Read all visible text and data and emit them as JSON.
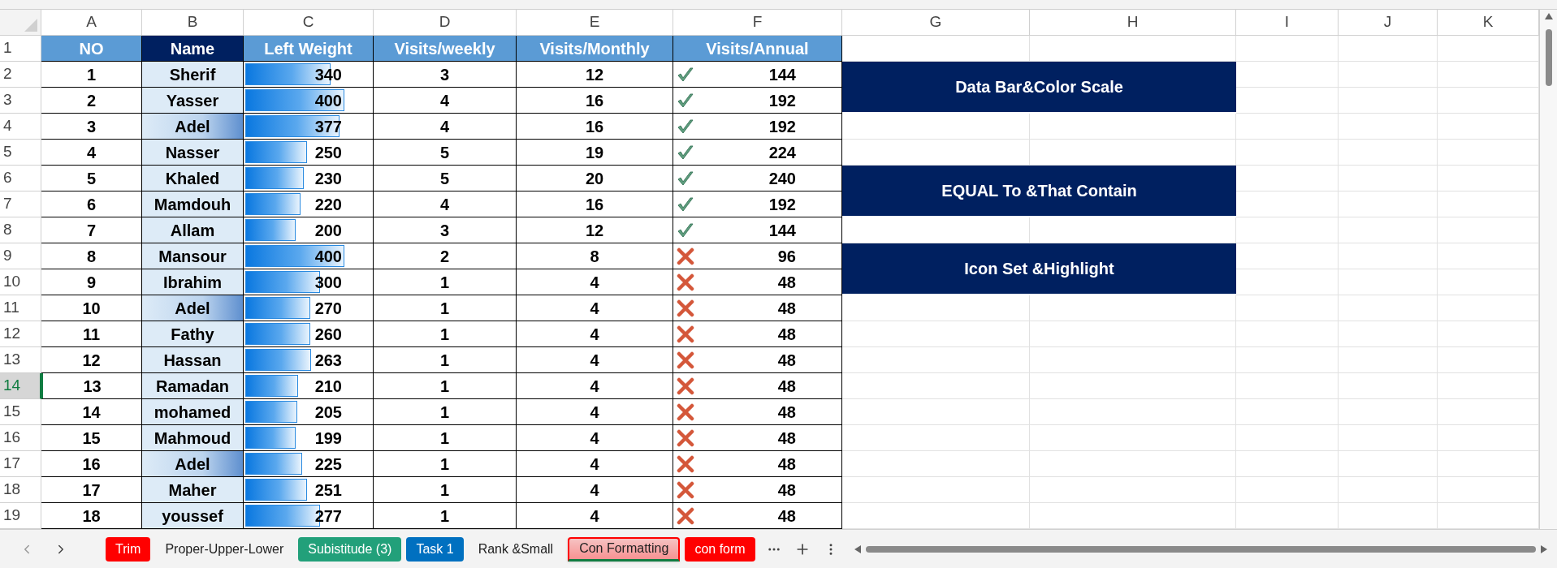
{
  "columns": [
    "A",
    "B",
    "C",
    "D",
    "E",
    "F",
    "G",
    "H",
    "I",
    "J",
    "K"
  ],
  "row_numbers": [
    "1",
    "2",
    "3",
    "4",
    "5",
    "6",
    "7",
    "8",
    "9",
    "10",
    "11",
    "12",
    "13",
    "14",
    "15",
    "16",
    "17",
    "18",
    "19"
  ],
  "headers": [
    {
      "text": "NO",
      "color": "#5b9bd5"
    },
    {
      "text": "Name",
      "color": "#002060"
    },
    {
      "text": "Left Weight",
      "color": "#5b9bd5"
    },
    {
      "text": "Visits/weekly",
      "color": "#5b9bd5"
    },
    {
      "text": "Visits/Monthly",
      "color": "#5b9bd5"
    },
    {
      "text": "Visits/Annual",
      "color": "#5b9bd5"
    }
  ],
  "rows": [
    {
      "no": "1",
      "name": "Sherif",
      "duplicate": false,
      "weight": "340",
      "level": 0.66,
      "weekly": "3",
      "monthly": "12",
      "kind": "check",
      "annual": "144",
      "selected": false
    },
    {
      "no": "2",
      "name": "Yasser",
      "duplicate": false,
      "weight": "400",
      "level": 0.77,
      "weekly": "4",
      "monthly": "16",
      "kind": "check",
      "annual": "192",
      "selected": false
    },
    {
      "no": "3",
      "name": "Adel",
      "duplicate": true,
      "weight": "377",
      "level": 0.73,
      "weekly": "4",
      "monthly": "16",
      "kind": "check",
      "annual": "192",
      "selected": false
    },
    {
      "no": "4",
      "name": "Nasser",
      "duplicate": false,
      "weight": "250",
      "level": 0.48,
      "weekly": "5",
      "monthly": "19",
      "kind": "check",
      "annual": "224",
      "selected": false
    },
    {
      "no": "5",
      "name": "Khaled",
      "duplicate": false,
      "weight": "230",
      "level": 0.45,
      "weekly": "5",
      "monthly": "20",
      "kind": "check",
      "annual": "240",
      "selected": false
    },
    {
      "no": "6",
      "name": "Mamdouh",
      "duplicate": false,
      "weight": "220",
      "level": 0.43,
      "weekly": "4",
      "monthly": "16",
      "kind": "check",
      "annual": "192",
      "selected": false
    },
    {
      "no": "7",
      "name": "Allam",
      "duplicate": false,
      "weight": "200",
      "level": 0.39,
      "weekly": "3",
      "monthly": "12",
      "kind": "check",
      "annual": "144",
      "selected": false
    },
    {
      "no": "8",
      "name": "Mansour",
      "duplicate": false,
      "weight": "400",
      "level": 0.77,
      "weekly": "2",
      "monthly": "8",
      "kind": "cross",
      "annual": "96",
      "selected": false
    },
    {
      "no": "9",
      "name": "Ibrahim",
      "duplicate": false,
      "weight": "300",
      "level": 0.58,
      "weekly": "1",
      "monthly": "4",
      "kind": "cross",
      "annual": "48",
      "selected": false
    },
    {
      "no": "10",
      "name": "Adel",
      "duplicate": true,
      "weight": "270",
      "level": 0.5,
      "weekly": "1",
      "monthly": "4",
      "kind": "cross",
      "annual": "48",
      "selected": false
    },
    {
      "no": "11",
      "name": "Fathy",
      "duplicate": false,
      "weight": "260",
      "level": 0.5,
      "weekly": "1",
      "monthly": "4",
      "kind": "cross",
      "annual": "48",
      "selected": false
    },
    {
      "no": "12",
      "name": "Hassan",
      "duplicate": false,
      "weight": "263",
      "level": 0.51,
      "weekly": "1",
      "monthly": "4",
      "kind": "cross",
      "annual": "48",
      "selected": false
    },
    {
      "no": "13",
      "name": "Ramadan",
      "duplicate": false,
      "weight": "210",
      "level": 0.41,
      "weekly": "1",
      "monthly": "4",
      "kind": "cross",
      "annual": "48",
      "selected": true
    },
    {
      "no": "14",
      "name": "mohamed",
      "duplicate": false,
      "weight": "205",
      "level": 0.4,
      "weekly": "1",
      "monthly": "4",
      "kind": "cross",
      "annual": "48",
      "selected": false
    },
    {
      "no": "15",
      "name": "Mahmoud",
      "duplicate": false,
      "weight": "199",
      "level": 0.39,
      "weekly": "1",
      "monthly": "4",
      "kind": "cross",
      "annual": "48",
      "selected": false
    },
    {
      "no": "16",
      "name": "Adel",
      "duplicate": true,
      "weight": "225",
      "level": 0.44,
      "weekly": "1",
      "monthly": "4",
      "kind": "cross",
      "annual": "48",
      "selected": false
    },
    {
      "no": "17",
      "name": "Maher",
      "duplicate": false,
      "weight": "251",
      "level": 0.48,
      "weekly": "1",
      "monthly": "4",
      "kind": "cross",
      "annual": "48",
      "selected": false
    },
    {
      "no": "18",
      "name": "youssef",
      "duplicate": false,
      "weight": "277",
      "level": 0.58,
      "weekly": "1",
      "monthly": "4",
      "kind": "cross",
      "annual": "48",
      "selected": false
    }
  ],
  "buttons": [
    "Data Bar&Color Scale",
    "EQUAL To &That Contain",
    "Icon Set &Highlight"
  ],
  "sheet_tabs": [
    {
      "label": "Trim",
      "color": "#ff0000",
      "selected": false
    },
    {
      "label": "Proper-Upper-Lower",
      "selected": false
    },
    {
      "label": "Subistitude (3)",
      "color": "#22a07a",
      "selected": false
    },
    {
      "label": "Task 1",
      "color": "#0070c0",
      "selected": false
    },
    {
      "label": "Rank &Small",
      "selected": false
    },
    {
      "label": "Con Formatting",
      "color": "#ff0000",
      "selected": true
    },
    {
      "label": "con form",
      "color": "#ff0000",
      "selected": false
    }
  ]
}
